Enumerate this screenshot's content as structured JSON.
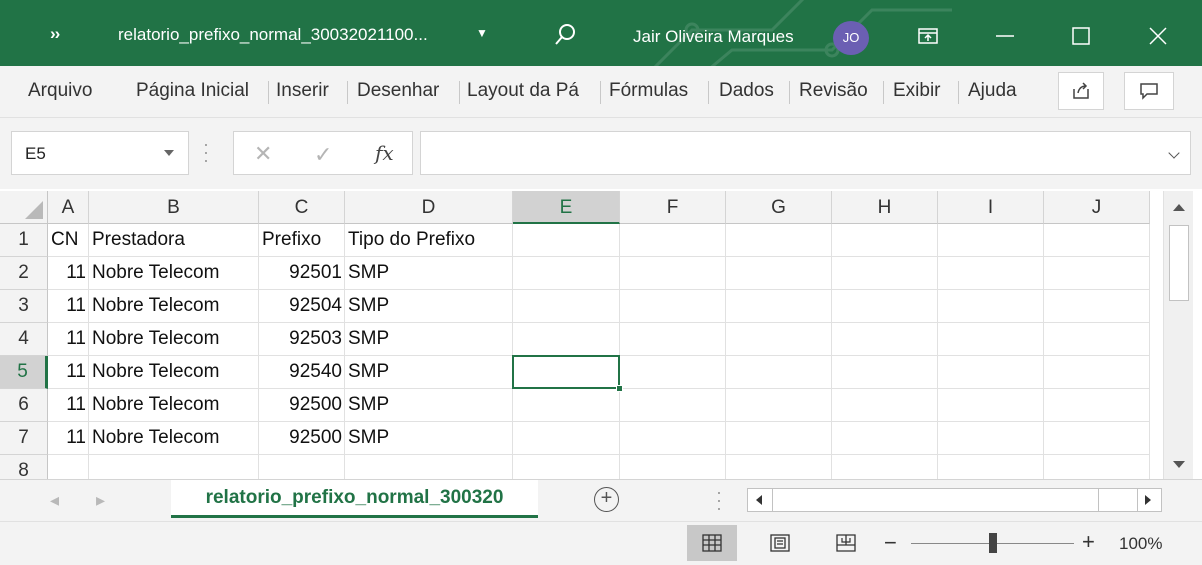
{
  "titlebar": {
    "more_label": "››",
    "title": "relatorio_prefixo_normal_30032021100...",
    "user_name": "Jair Oliveira Marques",
    "avatar_initials": "JO",
    "accent_color": "#217346"
  },
  "ribbon": {
    "tabs": [
      "Arquivo",
      "Página Inicial",
      "Inserir",
      "Desenhar",
      "Layout da Pá",
      "Fórmulas",
      "Dados",
      "Revisão",
      "Exibir",
      "Ajuda"
    ],
    "share_icon": "share-icon",
    "comments_icon": "comment-icon"
  },
  "formula_bar": {
    "name_box": "E5",
    "fx_label": "fx",
    "formula_value": ""
  },
  "grid": {
    "columns": [
      "A",
      "B",
      "C",
      "D",
      "E",
      "F",
      "G",
      "H",
      "I",
      "J"
    ],
    "row_numbers": [
      "1",
      "2",
      "3",
      "4",
      "5",
      "6",
      "7",
      "8"
    ],
    "selected_cell": "E5",
    "header_row": [
      "CN",
      "Prestadora",
      "Prefixo",
      "Tipo do Prefixo"
    ],
    "rows": [
      [
        "11",
        "Nobre Telecom",
        "92501",
        "SMP"
      ],
      [
        "11",
        "Nobre Telecom",
        "92504",
        "SMP"
      ],
      [
        "11",
        "Nobre Telecom",
        "92503",
        "SMP"
      ],
      [
        "11",
        "Nobre Telecom",
        "92540",
        "SMP"
      ],
      [
        "11",
        "Nobre Telecom",
        "92500",
        "SMP"
      ],
      [
        "11",
        "Nobre Telecom",
        "92500",
        "SMP"
      ]
    ]
  },
  "sheets": {
    "active_tab": "relatorio_prefixo_normal_300320",
    "add_label": "+"
  },
  "statusbar": {
    "zoom": "100%",
    "zoom_minus": "−",
    "zoom_plus": "+",
    "zoom_level": 1.0
  }
}
